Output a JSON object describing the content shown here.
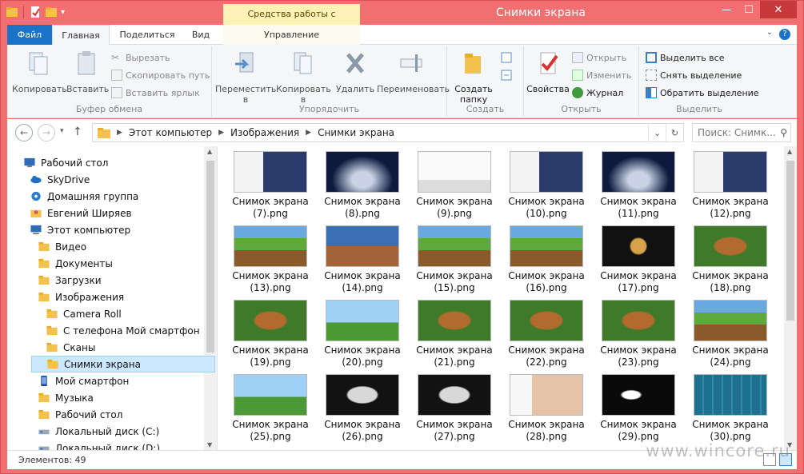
{
  "window": {
    "title": "Снимки экрана",
    "contextual_tab": "Средства работы с рисунками",
    "minimize": "—",
    "maximize": "☐",
    "close": "✕"
  },
  "tabs": {
    "file": "Файл",
    "home": "Главная",
    "share": "Поделиться",
    "view": "Вид",
    "manage": "Управление",
    "help": "?"
  },
  "ribbon": {
    "clipboard": {
      "name": "Буфер обмена",
      "copy": "Копировать",
      "paste": "Вставить",
      "cut": "Вырезать",
      "copy_path": "Скопировать путь",
      "paste_shortcut": "Вставить ярлык"
    },
    "organize": {
      "name": "Упорядочить",
      "move_to": "Переместить",
      "move_to_2": "в",
      "copy_to": "Копировать",
      "copy_to_2": "в",
      "delete": "Удалить",
      "rename": "Переименовать"
    },
    "create": {
      "name": "Создать",
      "new_folder": "Создать",
      "new_folder_2": "папку"
    },
    "open": {
      "name": "Открыть",
      "properties": "Свойства",
      "open": "Открыть",
      "edit": "Изменить",
      "history": "Журнал"
    },
    "select": {
      "name": "Выделить",
      "select_all": "Выделить все",
      "select_none": "Снять выделение",
      "invert": "Обратить выделение"
    }
  },
  "address": {
    "back": "←",
    "forward": "→",
    "up": "↑",
    "crumbs": [
      "Этот компьютер",
      "Изображения",
      "Снимки экрана"
    ],
    "dropdown": "⌄",
    "refresh": "↻",
    "search_placeholder": "Поиск: Снимк..."
  },
  "nav_tree": [
    {
      "label": "Рабочий стол",
      "icon": "desktop-icon",
      "level": 0
    },
    {
      "label": "SkyDrive",
      "icon": "cloud-icon",
      "level": 1
    },
    {
      "label": "Домашняя группа",
      "icon": "homegroup-icon",
      "level": 1
    },
    {
      "label": "Евгений Ширяев",
      "icon": "user-folder-icon",
      "level": 1
    },
    {
      "label": "Этот компьютер",
      "icon": "computer-icon",
      "level": 1
    },
    {
      "label": "Видео",
      "icon": "folder-icon",
      "level": 2
    },
    {
      "label": "Документы",
      "icon": "folder-icon",
      "level": 2
    },
    {
      "label": "Загрузки",
      "icon": "folder-icon",
      "level": 2
    },
    {
      "label": "Изображения",
      "icon": "folder-icon",
      "level": 2
    },
    {
      "label": "Camera Roll",
      "icon": "folder-icon",
      "level": 3
    },
    {
      "label": "С телефона Мой смартфон",
      "icon": "folder-icon",
      "level": 3
    },
    {
      "label": "Сканы",
      "icon": "folder-icon",
      "level": 3
    },
    {
      "label": "Снимки экрана",
      "icon": "folder-icon",
      "level": 3,
      "selected": true
    },
    {
      "label": "Мой смартфон",
      "icon": "phone-icon",
      "level": 2
    },
    {
      "label": "Музыка",
      "icon": "folder-icon",
      "level": 2
    },
    {
      "label": "Рабочий стол",
      "icon": "folder-icon",
      "level": 2
    },
    {
      "label": "Локальный диск (C:)",
      "icon": "drive-icon",
      "level": 2
    },
    {
      "label": "Локальный диск (D:)",
      "icon": "drive-icon",
      "level": 2
    }
  ],
  "files": [
    {
      "line1": "Снимок экрана",
      "line2": "(7).png",
      "kind": "desktop-car"
    },
    {
      "line1": "Снимок экрана",
      "line2": "(8).png",
      "kind": "car"
    },
    {
      "line1": "Снимок экрана",
      "line2": "(9).png",
      "kind": "desktop"
    },
    {
      "line1": "Снимок экрана",
      "line2": "(10).png",
      "kind": "desktop-car"
    },
    {
      "line1": "Снимок экрана",
      "line2": "(11).png",
      "kind": "car"
    },
    {
      "line1": "Снимок экрана",
      "line2": "(12).png",
      "kind": "desktop-car"
    },
    {
      "line1": "Снимок экрана",
      "line2": "(13).png",
      "kind": "farm"
    },
    {
      "line1": "Снимок экрана",
      "line2": "(14).png",
      "kind": "game-blue"
    },
    {
      "line1": "Снимок экрана",
      "line2": "(15).png",
      "kind": "farm"
    },
    {
      "line1": "Снимок экрана",
      "line2": "(16).png",
      "kind": "farm"
    },
    {
      "line1": "Снимок экрана",
      "line2": "(17).png",
      "kind": "dark-menu"
    },
    {
      "line1": "Снимок экрана",
      "line2": "(18).png",
      "kind": "game-menu"
    },
    {
      "line1": "Снимок экрана",
      "line2": "(19).png",
      "kind": "game-menu"
    },
    {
      "line1": "Снимок экрана",
      "line2": "(20).png",
      "kind": "game-sky"
    },
    {
      "line1": "Снимок экрана",
      "line2": "(21).png",
      "kind": "game-menu"
    },
    {
      "line1": "Снимок экрана",
      "line2": "(22).png",
      "kind": "game-menu"
    },
    {
      "line1": "Снимок экрана",
      "line2": "(23).png",
      "kind": "game-menu"
    },
    {
      "line1": "Снимок экрана",
      "line2": "(24).png",
      "kind": "farm"
    },
    {
      "line1": "Снимок экрана",
      "line2": "(25).png",
      "kind": "game-sky"
    },
    {
      "line1": "Снимок экрана",
      "line2": "(26).png",
      "kind": "dark-window"
    },
    {
      "line1": "Снимок экрана",
      "line2": "(27).png",
      "kind": "dark-window"
    },
    {
      "line1": "Снимок экрана",
      "line2": "(28).png",
      "kind": "photo-web"
    },
    {
      "line1": "Снимок экрана",
      "line2": "(29).png",
      "kind": "dark-dialog"
    },
    {
      "line1": "Снимок экрана",
      "line2": "(30).png",
      "kind": "start-screen"
    }
  ],
  "status": {
    "items": "Элементов: 49"
  },
  "watermark": "www.wincore.ru",
  "colors": {
    "accent": "#1a73c8",
    "frame": "#f16f70",
    "contextual": "#fcf2b5",
    "selection": "#cce8ff"
  }
}
